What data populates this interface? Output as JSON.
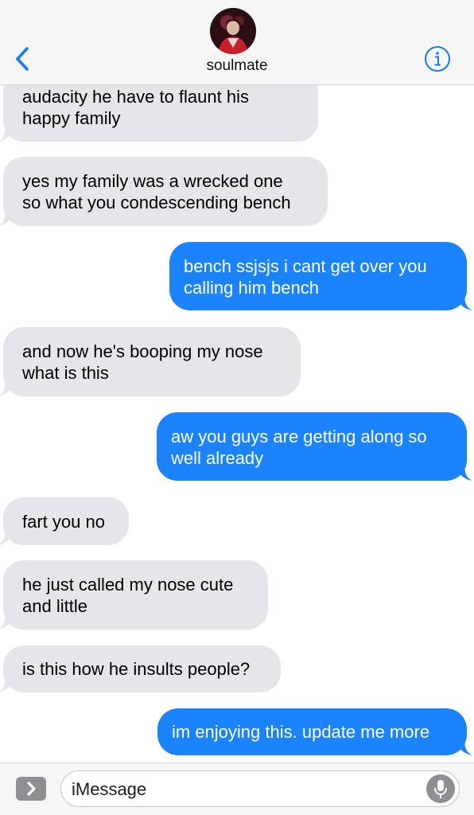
{
  "header": {
    "contact_name": "soulmate",
    "back_icon": "chevron-left-icon",
    "info_icon": "info-icon",
    "accent_color": "#1a7bf5"
  },
  "colors": {
    "incoming_bubble": "#e5e5ea",
    "outgoing_bubble": "#1b83fc",
    "outgoing_text": "#ffffff",
    "incoming_text": "#000000"
  },
  "messages": [
    {
      "direction": "incoming",
      "lines": [
        "audacity he have to flaunt his",
        "happy family"
      ]
    },
    {
      "direction": "incoming",
      "lines": [
        "yes my family was a wrecked one",
        "so what you condescending bench"
      ]
    },
    {
      "direction": "outgoing",
      "lines": [
        "bench ssjsjs i cant get over you",
        "calling him bench"
      ]
    },
    {
      "direction": "incoming",
      "lines": [
        "and now he's booping my nose",
        "what is this"
      ]
    },
    {
      "direction": "outgoing",
      "lines": [
        "aw you guys are getting along so",
        "well already"
      ]
    },
    {
      "direction": "incoming",
      "lines": [
        "fart you no"
      ]
    },
    {
      "direction": "incoming",
      "lines": [
        "he just called my nose cute",
        "and little"
      ]
    },
    {
      "direction": "incoming",
      "lines": [
        "is this how he insults people?"
      ]
    },
    {
      "direction": "outgoing",
      "lines": [
        "im enjoying this. update me more"
      ]
    }
  ],
  "input_bar": {
    "placeholder": "iMessage",
    "apps_icon": "chevron-right-icon",
    "mic_icon": "microphone-icon"
  }
}
